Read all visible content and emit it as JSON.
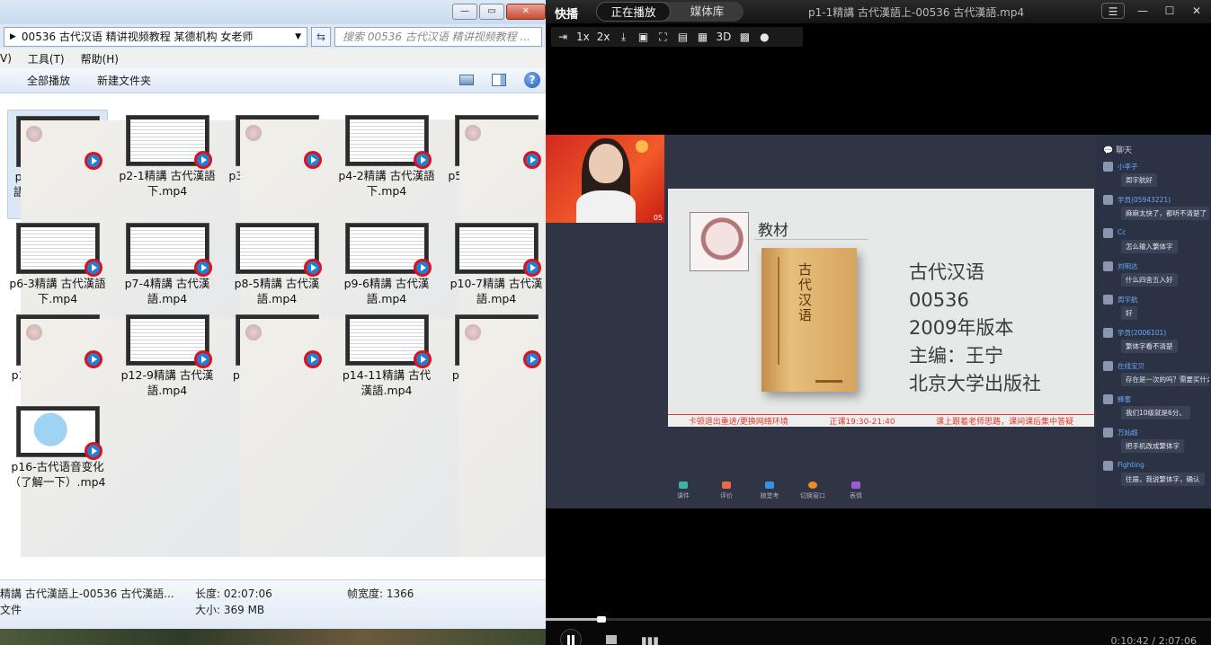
{
  "explorer": {
    "address": "00536 古代汉语 精讲视频教程 某德机构 女老师",
    "search_placeholder": "搜索 00536 古代汉语 精讲视频教程 ...",
    "menu": [
      "V)",
      "工具(T)",
      "帮助(H)"
    ],
    "commands": {
      "play_all": "全部播放",
      "new_folder": "新建文件夹"
    },
    "files": [
      {
        "label": "p1-1精講 古代漢語上-00536 古代漢語.mp4",
        "selected": true,
        "style": "slide"
      },
      {
        "label": "p2-1精講 古代漢語下.mp4",
        "style": "doc"
      },
      {
        "label": "p3-2精講 古代漢語上.mp4",
        "style": "slide"
      },
      {
        "label": "p4-2精講 古代漢語下.mp4",
        "style": "doc"
      },
      {
        "label": "p5-3精講 古代漢語上.mp4",
        "style": "slide"
      },
      {
        "label": "p6-3精講 古代漢語下.mp4",
        "style": "doc"
      },
      {
        "label": "p7-4精講 古代漢語.mp4",
        "style": "doc"
      },
      {
        "label": "p8-5精講 古代漢語.mp4",
        "style": "doc"
      },
      {
        "label": "p9-6精講 古代漢語.mp4",
        "style": "doc"
      },
      {
        "label": "p10-7精講 古代漢語.mp4",
        "style": "doc"
      },
      {
        "label": "p11-8精講 古代漢語.mp4",
        "style": "slide"
      },
      {
        "label": "p12-9精講 古代漢語.mp4",
        "style": "doc"
      },
      {
        "label": "p13-10精講 古代漢語.mp4",
        "style": "slide"
      },
      {
        "label": "p14-11精講 古代漢語.mp4",
        "style": "doc"
      },
      {
        "label": "p15-12精講 古代漢語.mp4",
        "style": "slide"
      },
      {
        "label": "p16-古代语音变化（了解一下）.mp4",
        "style": "map"
      }
    ],
    "status": {
      "name": "精講 古代漢語上-00536 古代漢語...",
      "type": "文件",
      "duration_label": "长度: 02:07:06",
      "size_label": "大小: 369 MB",
      "width_label": "帧宽度: 1366"
    }
  },
  "player": {
    "brand": "快播",
    "tabs": [
      "正在播放",
      "媒体库"
    ],
    "title": "p1-1精講 古代漢語上-00536 古代漢語.mp4",
    "toolbar": [
      "⇥",
      "1x",
      "2x",
      "⤓",
      "▣",
      "⛶",
      "▤",
      "▦",
      "3D",
      "▩",
      "●"
    ],
    "slide": {
      "heading": "教材",
      "book_title": "古代汉语",
      "lines": [
        "古代汉语",
        "00536",
        "2009年版本",
        "主编：王宁",
        "北京大学出版社"
      ],
      "banner": [
        "卡顿退出重进/更换网络环境",
        "正课19:30-21:40",
        "课上跟着老师思路，课间课后集中答疑"
      ]
    },
    "cam_number": "05",
    "bottom_tools": [
      "课件",
      "评价",
      "随堂考",
      "切换窗口",
      "表情"
    ],
    "chat": {
      "header": "聊天",
      "messages": [
        {
          "name": "小李子",
          "text": "周宇航好"
        },
        {
          "name": "学员(05943221)",
          "text": "麻麻太快了，都听不清楚了"
        },
        {
          "name": "Cc",
          "text": "怎么输入繁体字"
        },
        {
          "name": "刘明达",
          "text": "什么四舍五入好"
        },
        {
          "name": "周宇航",
          "text": "好"
        },
        {
          "name": "学员(2006101)",
          "text": "繁体字看不清楚"
        },
        {
          "name": "在线宝贝",
          "text": "存在是一次的吗？需要买什么教材吗？"
        },
        {
          "name": "蜂蜜",
          "text": "我们10级就是6分。"
        },
        {
          "name": "万灿超",
          "text": "把手机改成繁体字"
        },
        {
          "name": "Fighting",
          "text": "往届，我说繁体字，确认"
        }
      ]
    },
    "time": "0:10:42 / 2:07:06",
    "progress": 0.084
  }
}
